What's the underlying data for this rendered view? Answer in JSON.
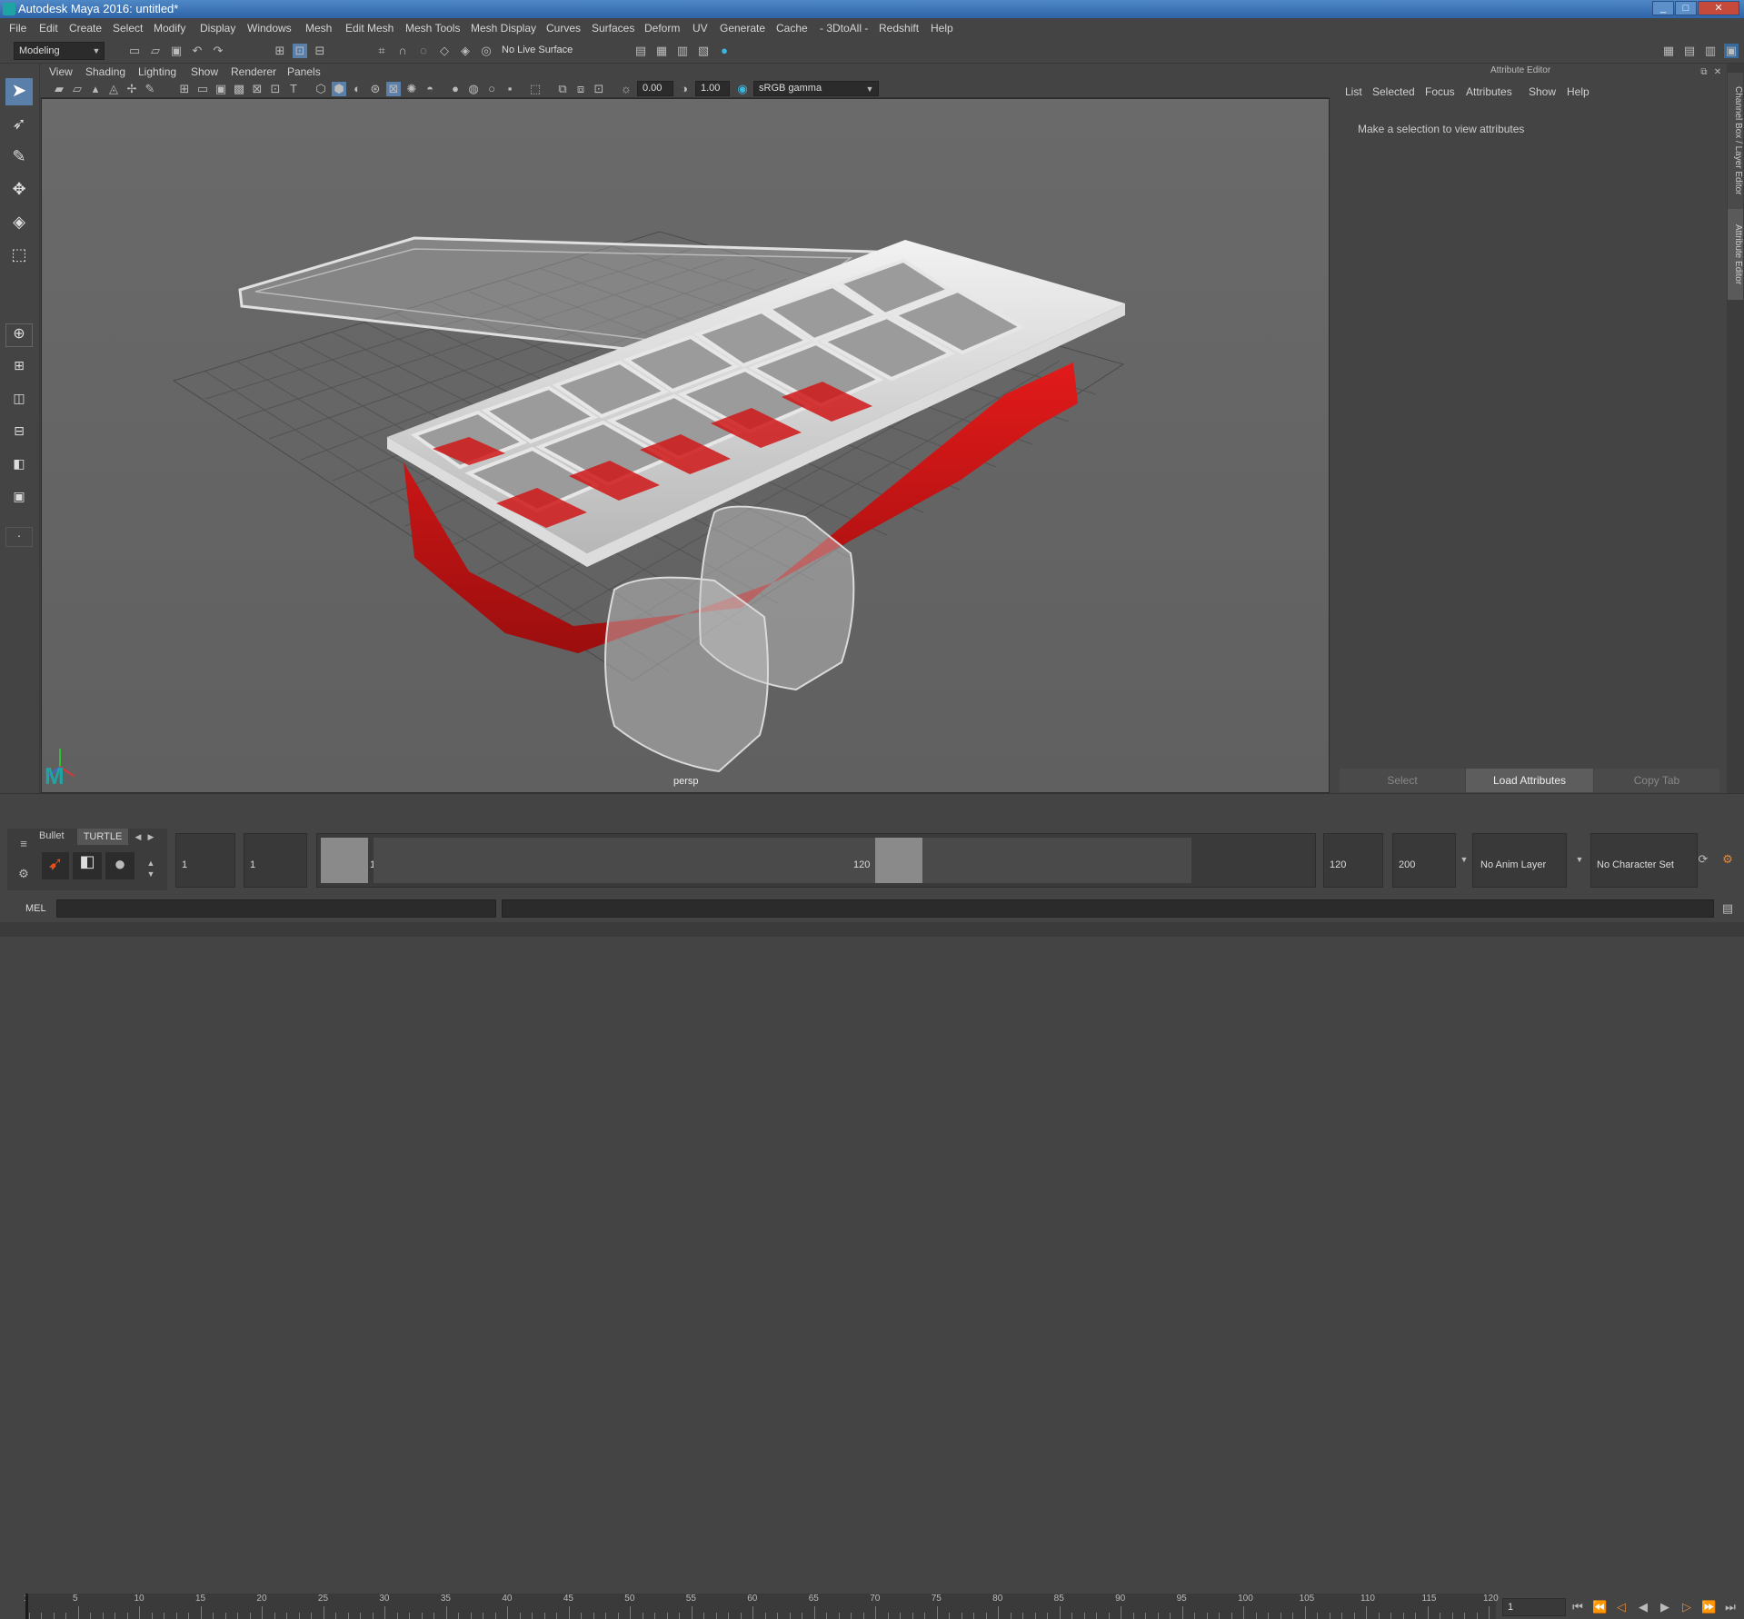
{
  "window": {
    "title": "Autodesk Maya 2016: untitled*",
    "controls": [
      "_",
      "□",
      "✕"
    ]
  },
  "menubar": [
    "File",
    "Edit",
    "Create",
    "Select",
    "Modify",
    "Display",
    "Windows",
    "Mesh",
    "Edit Mesh",
    "Mesh Tools",
    "Mesh Display",
    "Curves",
    "Surfaces",
    "Deform",
    "UV",
    "Generate",
    "Cache",
    "- 3DtoAll -",
    "Redshift",
    "Help"
  ],
  "shelf": {
    "mode": "Modeling",
    "live_surface": "No Live Surface"
  },
  "viewport": {
    "menu": [
      "View",
      "Shading",
      "Lighting",
      "Show",
      "Renderer",
      "Panels"
    ],
    "exposure": "0.00",
    "gamma": "1.00",
    "color_space": "sRGB gamma",
    "camera": "persp"
  },
  "attribute_editor": {
    "title": "Attribute Editor",
    "menu": [
      "List",
      "Selected",
      "Focus",
      "Attributes",
      "Show",
      "Help"
    ],
    "message": "Make a selection to view attributes",
    "buttons": {
      "select": "Select",
      "load": "Load Attributes",
      "copy": "Copy Tab"
    }
  },
  "side_tabs": {
    "channel_box": "Channel Box / Layer Editor",
    "attribute_editor": "Attribute Editor"
  },
  "timeline": {
    "ticks": [
      "1",
      "5",
      "10",
      "15",
      "20",
      "25",
      "30",
      "35",
      "40",
      "45",
      "50",
      "55",
      "60",
      "65",
      "70",
      "75",
      "80",
      "85",
      "90",
      "95",
      "100",
      "105",
      "110",
      "115",
      "120"
    ],
    "current_frame": "1"
  },
  "range": {
    "shelf_tabs": [
      "Bullet",
      "TURTLE"
    ],
    "start": "1",
    "playback_start": "1",
    "slider_start": "1",
    "slider_end": "120",
    "playback_end": "120",
    "end": "200",
    "anim_layer": "No Anim Layer",
    "character_set": "No Character Set"
  },
  "command_line": {
    "label": "MEL"
  }
}
